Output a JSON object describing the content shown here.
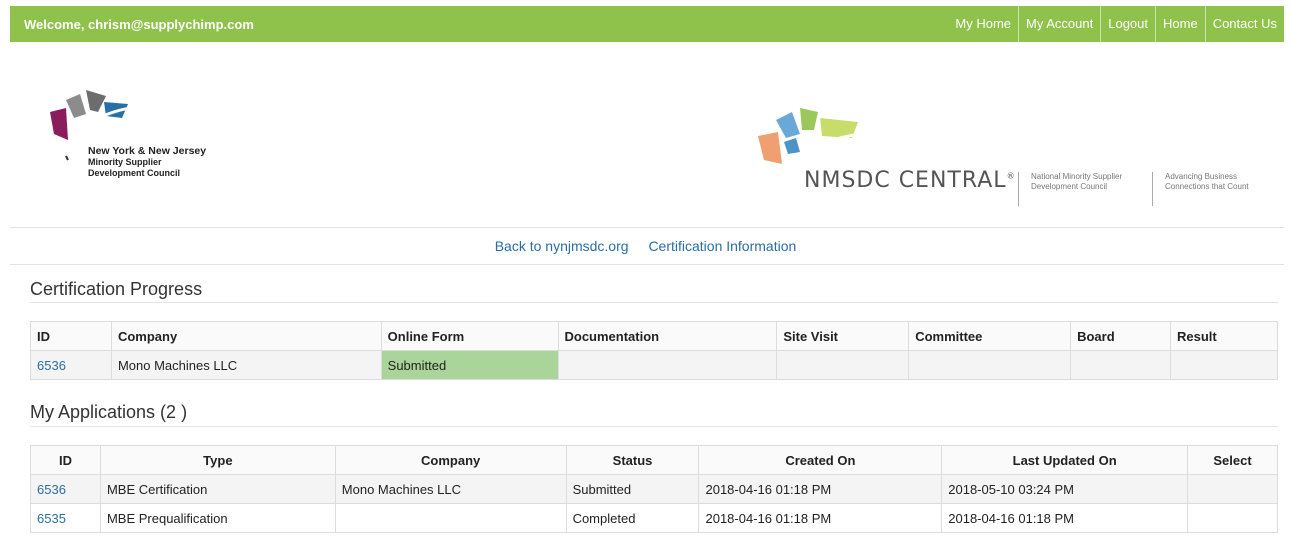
{
  "header": {
    "welcome": "Welcome, chrism@supplychimp.com",
    "nav": [
      "My Home",
      "My Account",
      "Logout",
      "Home",
      "Contact Us"
    ]
  },
  "logo_left": {
    "line1": "New York & New Jersey",
    "line2": "Minority Supplier",
    "line3": "Development Council"
  },
  "logo_right": {
    "name": "NMSDC CENTRAL",
    "reg": "®",
    "tag1_line1": "National Minority Supplier",
    "tag1_line2": "Development Council",
    "tag2_line1": "Advancing Business",
    "tag2_line2": "Connections that Count"
  },
  "links": {
    "back": "Back to nynjmsdc.org",
    "cert_info": "Certification Information"
  },
  "progress": {
    "title": "Certification Progress",
    "columns": [
      "ID",
      "Company",
      "Online Form",
      "Documentation",
      "Site Visit",
      "Committee",
      "Board",
      "Result"
    ],
    "row": {
      "id": "6536",
      "company": "Mono Machines LLC",
      "online_form": "Submitted",
      "documentation": "",
      "site_visit": "",
      "committee": "",
      "board": "",
      "result": ""
    }
  },
  "applications": {
    "title": "My Applications (2 )",
    "columns": [
      "ID",
      "Type",
      "Company",
      "Status",
      "Created On",
      "Last Updated On",
      "Select"
    ],
    "rows": [
      {
        "id": "6536",
        "type": "MBE Certification",
        "company": "Mono Machines LLC",
        "status": "Submitted",
        "created": "2018-04-16 01:18 PM",
        "updated": "2018-05-10 03:24 PM",
        "select": ""
      },
      {
        "id": "6535",
        "type": "MBE Prequalification",
        "company": "",
        "status": "Completed",
        "created": "2018-04-16 01:18 PM",
        "updated": "2018-04-16 01:18 PM",
        "select": ""
      }
    ]
  },
  "colors": {
    "header_green": "#8ec24a",
    "link_blue": "#2a6ea6",
    "submitted_green": "#a9d49a"
  }
}
